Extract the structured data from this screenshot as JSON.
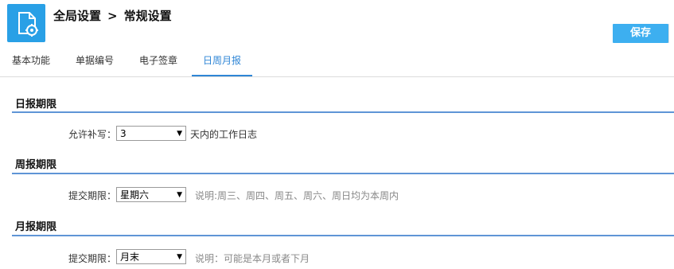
{
  "header": {
    "icon": "document-settings-icon",
    "breadcrumb": {
      "root": "全局设置",
      "separator": ">",
      "current": "常规设置"
    },
    "save_label": "保存",
    "accent_color": "#3daff0"
  },
  "tabs": [
    {
      "label": "基本功能",
      "active": false
    },
    {
      "label": "单据编号",
      "active": false
    },
    {
      "label": "电子签章",
      "active": false
    },
    {
      "label": "日周月报",
      "active": true
    }
  ],
  "sections": {
    "daily": {
      "title": "日报期限",
      "label": "允许补写：",
      "value": "3",
      "suffix": "天内的工作日志"
    },
    "weekly": {
      "title": "周报期限",
      "label": "提交期限：",
      "value": "星期六",
      "note": "说明:周三、周四、周五、周六、周日均为本周内"
    },
    "monthly": {
      "title": "月报期限",
      "label": "提交期限：",
      "value": "月末",
      "note": "说明：可能是本月或者下月"
    }
  }
}
